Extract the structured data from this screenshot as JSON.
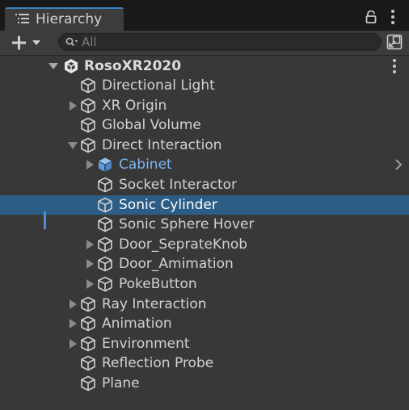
{
  "window": {
    "tab_label": "Hierarchy",
    "tab_icon": "list-icon",
    "lock_icon": "lock-icon",
    "menu_icon": "kebab-menu-icon"
  },
  "toolbar": {
    "add_icon": "plus-icon",
    "dropdown_icon": "caret-down-icon",
    "search_icon": "search-icon",
    "search_placeholder": "All",
    "scene_visibility_icon": "scene-visibility-icon"
  },
  "colors": {
    "accent": "#3b82c4",
    "selected_row": "#2c5d87",
    "prefab_text": "#7fb4f2",
    "text": "#d2d2d2"
  },
  "tree": {
    "root": {
      "label": "RosoXR2020",
      "expanded": true,
      "icon": "unity-logo-icon"
    },
    "items": [
      {
        "label": "Directional Light",
        "depth": 1,
        "arrow": "none",
        "icon": "gameobject-cube-icon"
      },
      {
        "label": "XR Origin",
        "depth": 1,
        "arrow": "collapsed",
        "icon": "gameobject-cube-icon"
      },
      {
        "label": "Global Volume",
        "depth": 1,
        "arrow": "none",
        "icon": "gameobject-cube-icon"
      },
      {
        "label": "Direct Interaction",
        "depth": 1,
        "arrow": "expanded",
        "icon": "gameobject-cube-icon"
      },
      {
        "label": "Cabinet",
        "depth": 2,
        "arrow": "collapsed",
        "icon": "prefab-cube-icon",
        "prefab": true
      },
      {
        "label": "Socket Interactor",
        "depth": 2,
        "arrow": "none",
        "icon": "gameobject-cube-icon"
      },
      {
        "label": "Sonic Cylinder",
        "depth": 2,
        "arrow": "none",
        "icon": "gameobject-cube-icon",
        "selected": true
      },
      {
        "label": "Sonic Sphere Hover",
        "depth": 2,
        "arrow": "none",
        "icon": "gameobject-cube-icon"
      },
      {
        "label": "Door_SeprateKnob",
        "depth": 2,
        "arrow": "collapsed",
        "icon": "gameobject-cube-icon"
      },
      {
        "label": "Door_Amimation",
        "depth": 2,
        "arrow": "collapsed",
        "icon": "gameobject-cube-icon"
      },
      {
        "label": "PokeButton",
        "depth": 2,
        "arrow": "collapsed",
        "icon": "gameobject-cube-icon"
      },
      {
        "label": "Ray Interaction",
        "depth": 1,
        "arrow": "collapsed",
        "icon": "gameobject-cube-icon"
      },
      {
        "label": "Animation",
        "depth": 1,
        "arrow": "collapsed",
        "icon": "gameobject-cube-icon"
      },
      {
        "label": "Environment",
        "depth": 1,
        "arrow": "collapsed",
        "icon": "gameobject-cube-icon"
      },
      {
        "label": "Reflection Probe",
        "depth": 1,
        "arrow": "none",
        "icon": "gameobject-cube-icon"
      },
      {
        "label": "Plane",
        "depth": 1,
        "arrow": "none",
        "icon": "gameobject-cube-icon"
      }
    ]
  }
}
